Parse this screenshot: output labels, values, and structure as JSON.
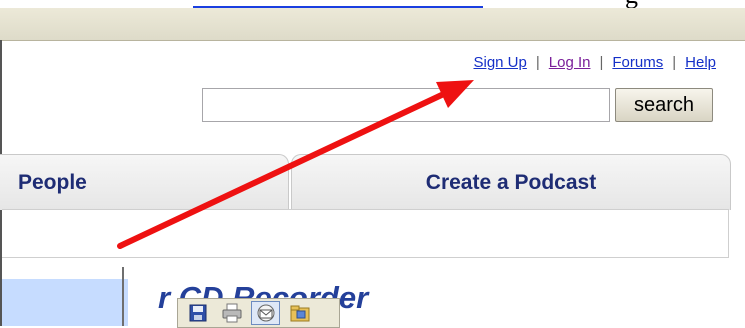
{
  "header_links": {
    "signup": "Sign Up",
    "login": "Log In",
    "forums": "Forums",
    "help": "Help",
    "separator": "|"
  },
  "search": {
    "value": "",
    "button_label": "search"
  },
  "tabs": [
    {
      "label": "People"
    },
    {
      "label": "Create a Podcast"
    }
  ],
  "main": {
    "heading": "r CD Recorder"
  },
  "image_toolbar": {
    "icons": [
      "save-icon",
      "print-icon",
      "email-icon",
      "folder-icon"
    ]
  },
  "colors": {
    "link": "#1530c8",
    "visited_link": "#7a1f9a",
    "tab_text": "#1e2c74",
    "heading": "#24409a",
    "arrow": "#ee1111"
  }
}
